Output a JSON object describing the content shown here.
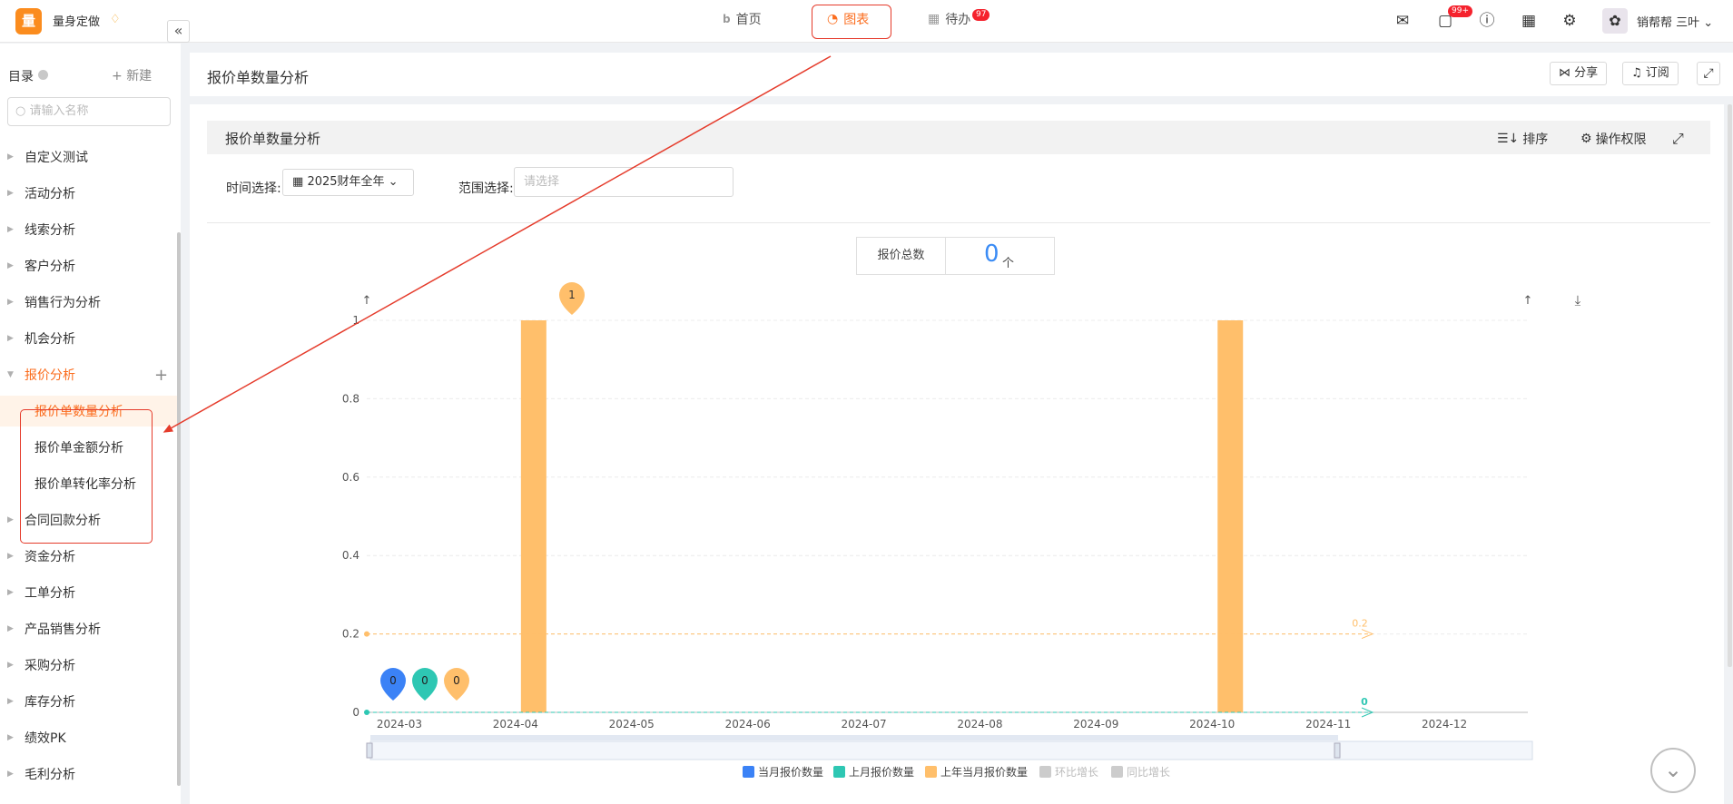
{
  "topbar": {
    "logo_char": "量",
    "app_name": "量身定做",
    "tabs": [
      {
        "label": "首页"
      },
      {
        "label": "图表"
      },
      {
        "label": "待办",
        "badge": "97"
      }
    ],
    "message_badge": "99+",
    "user_name": "销帮帮 三叶"
  },
  "sidebar": {
    "title": "目录",
    "new_label": "新建",
    "search_placeholder": "请输入名称",
    "items": [
      {
        "label": "自定义测试"
      },
      {
        "label": "活动分析"
      },
      {
        "label": "线索分析"
      },
      {
        "label": "客户分析"
      },
      {
        "label": "销售行为分析"
      },
      {
        "label": "机会分析"
      },
      {
        "label": "报价分析"
      },
      {
        "label": "报价单数量分析"
      },
      {
        "label": "报价单金额分析"
      },
      {
        "label": "报价单转化率分析"
      },
      {
        "label": "合同回款分析"
      },
      {
        "label": "资金分析"
      },
      {
        "label": "工单分析"
      },
      {
        "label": "产品销售分析"
      },
      {
        "label": "采购分析"
      },
      {
        "label": "库存分析"
      },
      {
        "label": "绩效PK"
      },
      {
        "label": "毛利分析"
      }
    ]
  },
  "main": {
    "title": "报价单数量分析",
    "share_label": "分享",
    "subscribe_label": "订阅"
  },
  "card": {
    "title": "报价单数量分析",
    "sort_label": "排序",
    "perm_label": "操作权限",
    "time_label": "时间选择:",
    "time_value": "2025财年全年",
    "range_label": "范围选择:",
    "range_placeholder": "请选择",
    "total_label": "报价总数",
    "total_value": "0",
    "total_unit": "个"
  },
  "chart_data": {
    "type": "bar",
    "categories": [
      "2024-03",
      "2024-04",
      "2024-05",
      "2024-06",
      "2024-07",
      "2024-08",
      "2024-09",
      "2024-10",
      "2024-11",
      "2024-12"
    ],
    "series": [
      {
        "name": "当月报价数量",
        "color": "#3b82f6",
        "values": [
          0,
          0,
          0,
          0,
          0,
          0,
          0,
          0,
          0,
          0
        ]
      },
      {
        "name": "上月报价数量",
        "color": "#2ec7b3",
        "values": [
          0,
          0,
          0,
          0,
          0,
          0,
          0,
          0,
          0,
          0
        ]
      },
      {
        "name": "上年当月报价数量",
        "color": "#ffbf6b",
        "values": [
          0,
          1,
          0,
          0,
          0,
          0,
          0,
          1,
          0,
          0
        ]
      },
      {
        "name": "环比增长",
        "color": "#cccccc",
        "values": []
      },
      {
        "name": "同比增长",
        "color": "#cccccc",
        "values": []
      }
    ],
    "yticks": [
      0,
      0.2,
      0.4,
      0.6,
      0.8,
      1
    ],
    "ylim": [
      0,
      1
    ],
    "markers": [
      {
        "label": "0",
        "color": "#3b82f6"
      },
      {
        "label": "0",
        "color": "#2ec7b3"
      },
      {
        "label": "0",
        "color": "#ffbf6b"
      },
      {
        "label": "1",
        "color": "#ffbf6b"
      }
    ],
    "avg_lines": [
      {
        "label": "0.2",
        "color": "#ffbf6b",
        "value": 0.2
      },
      {
        "label": "0",
        "color": "#2ec7b3",
        "value": 0
      }
    ]
  }
}
